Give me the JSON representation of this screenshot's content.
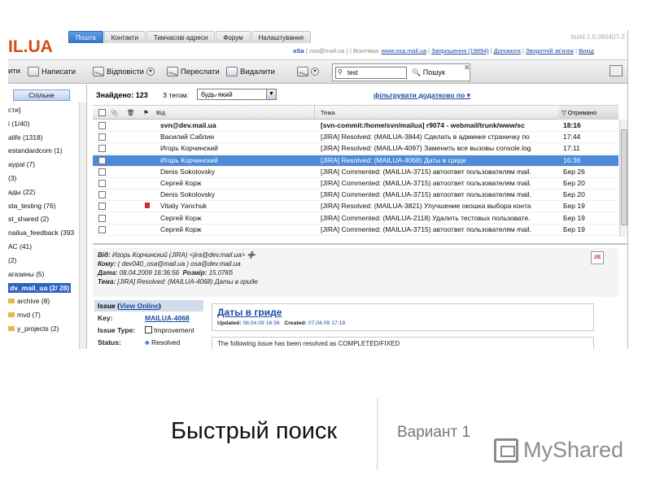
{
  "app": {
    "logo_prefix": "IL",
    "logo_suffix": ".UA",
    "tabs": [
      "Пошта",
      "Контакти",
      "Тимчасові адреси",
      "Форум",
      "Налаштування"
    ],
    "active_tab": "Пошта",
    "build": "build:1.0.090407-2",
    "user": "oSa",
    "user_email": "( osa@mail.ua )",
    "business_card_label": "Візитівка:",
    "business_card_url": "www.osa.mail.ua",
    "invitations": "Запрошення (19894)",
    "help": "Допомога",
    "feedback": "Зворотній зв'язок",
    "logout": "Вихід"
  },
  "toolbar": {
    "read_label": "ити",
    "write_label": "Написати",
    "reply_label": "Відповісти",
    "forward_label": "Переслати",
    "delete_label": "Видалити",
    "search_value": "test",
    "search_button": "Пошук"
  },
  "sidebar": {
    "tab_label": "Спільне",
    "items": [
      {
        "label": "сти]"
      },
      {
        "label": "і (1/40)"
      },
      {
        "label": "alife (1318)"
      },
      {
        "label": "estandardcom (1)"
      },
      {
        "label": "aypal (7)"
      },
      {
        "label": "(3)"
      },
      {
        "label": "ады (22)"
      },
      {
        "label": "sta_testing (76)"
      },
      {
        "label": "st_shared (2)"
      },
      {
        "label": "nailua_feedback (393"
      },
      {
        "label": "АС (41)"
      },
      {
        "label": "(2)"
      },
      {
        "label": "агазины (5)"
      },
      {
        "label": "dv_mail_ua (2/ 28)"
      },
      {
        "label": "archive (8)"
      },
      {
        "label": "mvd (7)"
      },
      {
        "label": "y_projects (2)"
      }
    ],
    "selected_index": 13
  },
  "list": {
    "found_label": "Знайдено: 123",
    "tag_label": "З тегом:",
    "tag_value": "будь-який",
    "filter_link": "фільтрувати додатково по",
    "col_from": "Від",
    "col_subject": "Тема",
    "col_received": "Отримано",
    "rows": [
      {
        "from": "svn@dev.mail.ua",
        "subject": "[svn-commit:/home/svn/mailua] r9074 - webmail/trunk/www/sc",
        "date": "18:16",
        "unread": true,
        "flag": false,
        "selected": false
      },
      {
        "from": "Василий Саблин",
        "subject": "[JIRA] Resolved: (MAILUA-3844) Сделать в админке страничку по",
        "date": "17:44",
        "unread": false,
        "flag": false,
        "selected": false
      },
      {
        "from": "Игорь Корчинский",
        "subject": "[JIRA] Resolved: (MAILUA-4097) Заменить все вызовы console.log",
        "date": "17:11",
        "unread": false,
        "flag": false,
        "selected": false
      },
      {
        "from": "Игорь Корчинский",
        "subject": "[JIRA] Resolved: (MAILUA-4068) Даты в гриде",
        "date": "16:36",
        "unread": false,
        "flag": false,
        "selected": true
      },
      {
        "from": "Denis Sokolovsky",
        "subject": "[JIRA] Commented: (MAILUA-3715) автоответ пользователям mail.",
        "date": "Бер 26",
        "unread": false,
        "flag": false,
        "selected": false
      },
      {
        "from": "Сергей Корж",
        "subject": "[JIRA] Commented: (MAILUA-3715) автоответ пользователям mail.",
        "date": "Бер 20",
        "unread": false,
        "flag": false,
        "selected": false
      },
      {
        "from": "Denis Sokolovsky",
        "subject": "[JIRA] Commented: (MAILUA-3715) автоответ пользователям mail.",
        "date": "Бер 20",
        "unread": false,
        "flag": false,
        "selected": false
      },
      {
        "from": "Vitaliy Yanchuk",
        "subject": "[JIRA] Resolved: (MAILUA-3821) Улучшение окошка выбора конта",
        "date": "Бер 19",
        "unread": false,
        "flag": true,
        "selected": false
      },
      {
        "from": "Сергей Корж",
        "subject": "[JIRA] Commented: (MAILUA-2118) Удалить тестовых пользовате.",
        "date": "Бер 19",
        "unread": false,
        "flag": false,
        "selected": false
      },
      {
        "from": "Сергей Корж",
        "subject": "[JIRA] Commented: (MAILUA-3715) автоответ пользователям mail.",
        "date": "Бер 19",
        "unread": false,
        "flag": false,
        "selected": false
      }
    ]
  },
  "preview": {
    "from_label": "Від:",
    "from_value": "Игорь Корчинский (JIRA) <jira@dev.mail.ua>",
    "to_label": "Кому:",
    "to_value": "( dev040_osa@mail.ua )  osa@dev.mail.ua",
    "date_label": "Дата:",
    "date_value": "08.04.2009 16:36:56",
    "size_label": "Розмір:",
    "size_value": "15.07Кб",
    "subject_label": "Тема:",
    "subject_value": "[JIRA] Resolved: (MAILUA-4068) Даты в гриде",
    "issue_label": "Issue",
    "view_online": "View Online",
    "key_label": "Key:",
    "key_value": "MAILUA-4068",
    "type_label": "Issue Type:",
    "type_value": "Improvement",
    "status_label": "Status:",
    "status_value": "Resolved",
    "issue_title": "Даты в гриде",
    "updated_label": "Updated:",
    "updated_value": "08.04.09 16:36",
    "created_label": "Created:",
    "created_value": "07.04.09 17:18",
    "resolved_text": "The following issue has been resolved as COMPLETED/FIXED"
  },
  "slide": {
    "caption": "Быстрый поиск",
    "variant": "Вариант 1",
    "brand": "MyShared"
  }
}
